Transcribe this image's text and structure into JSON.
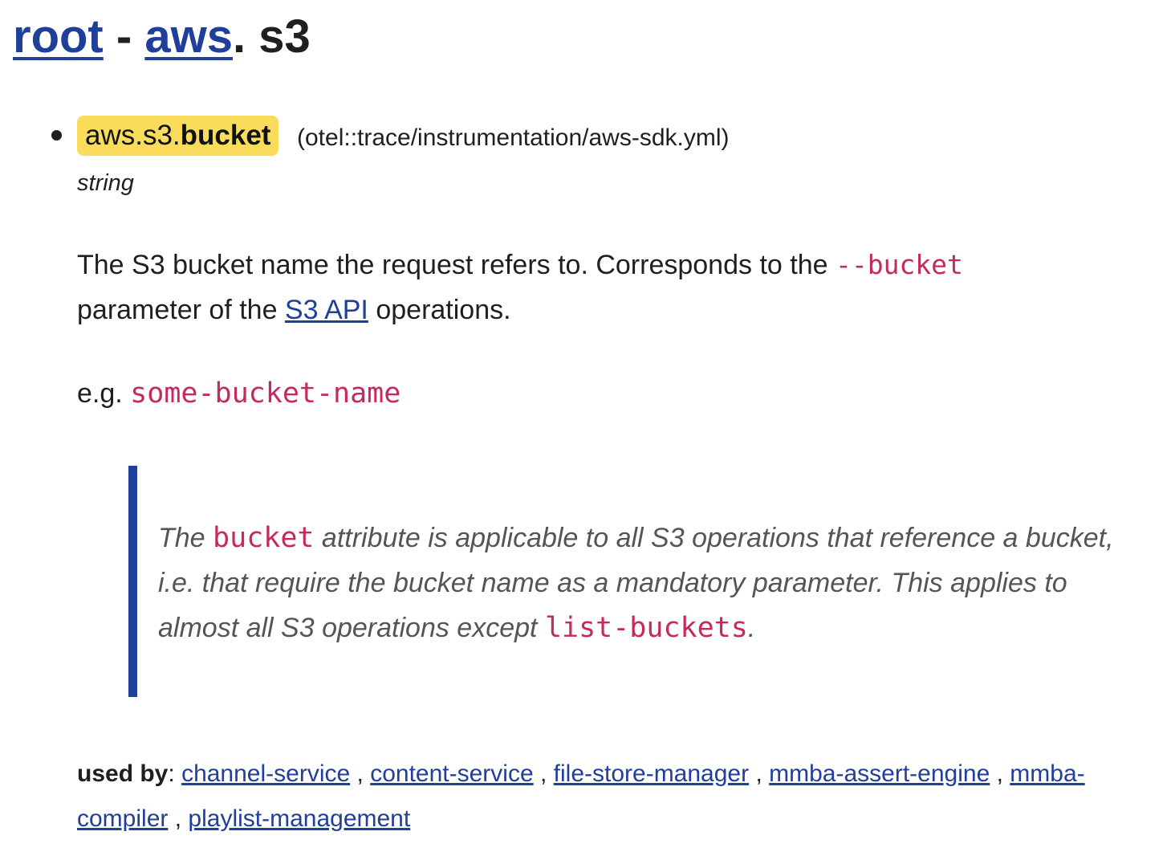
{
  "breadcrumb": {
    "root_link": "root",
    "separator": "-",
    "aws_link": "aws",
    "dot": ".",
    "current": "s3"
  },
  "attribute": {
    "name_prefix": "aws.s3.",
    "name_last": "bucket",
    "source": "(otel::trace/instrumentation/aws-sdk.yml)",
    "type": "string",
    "description": {
      "part1": "The S3 bucket name the request refers to. Corresponds to the ",
      "code1": "--bucket",
      "part2": " parameter of the ",
      "link": "S3 API",
      "part3": " operations."
    },
    "example": {
      "label": "e.g. ",
      "value": "some-bucket-name"
    },
    "note": {
      "part1": "The ",
      "code1": "bucket",
      "part2": " attribute is applicable to all S3 operations that reference a bucket, i.e. that require the bucket name as a mandatory parameter. This applies to almost all S3 operations except ",
      "code2": "list-buckets",
      "part3": "."
    }
  },
  "used_by": {
    "label": "used by",
    "colon": ":",
    "services": [
      "channel-service",
      "content-service",
      "file-store-manager",
      "mmba-assert-engine",
      "mmba-compiler",
      "playlist-management"
    ],
    "separator": ","
  }
}
